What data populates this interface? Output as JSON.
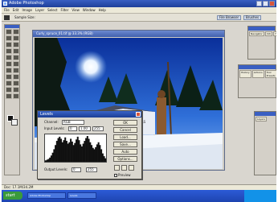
{
  "app": {
    "title": "Adobe Photoshop"
  },
  "menu": [
    "File",
    "Edit",
    "Image",
    "Layer",
    "Select",
    "Filter",
    "View",
    "Window",
    "Help"
  ],
  "options_bar": {
    "sample_label": "Sample Size:",
    "file_browser": "File Browser",
    "brushes": "Brushes"
  },
  "image_window": {
    "title": "Curly_spruce_01.tif @ 33.3% (RGB)"
  },
  "photo": {
    "sign_text": "UNITY ONE\nSPIRIT LEADERS"
  },
  "navigator": {
    "tabs": [
      "Navigator",
      "Info",
      "Histogram"
    ]
  },
  "history": {
    "tabs": [
      "History",
      "Actions",
      "Tool Presets"
    ]
  },
  "layers": {
    "tabs": [
      "Layers"
    ]
  },
  "levels": {
    "title": "Levels",
    "channel_label": "Channel:",
    "channel_value": "RGB",
    "input_label": "Input Levels:",
    "input_values": [
      "0",
      "1.00",
      "255"
    ],
    "output_label": "Output Levels:",
    "output_values": [
      "0",
      "255"
    ],
    "buttons": [
      "OK",
      "Cancel",
      "Load...",
      "Save...",
      "Auto",
      "Options..."
    ],
    "preview_label": "Preview",
    "histogram": [
      2,
      3,
      4,
      6,
      9,
      13,
      18,
      24,
      30,
      34,
      36,
      33,
      28,
      31,
      35,
      30,
      26,
      28,
      33,
      29,
      24,
      27,
      32,
      36,
      31,
      25,
      22,
      26,
      30,
      34,
      37,
      33,
      28,
      24,
      20,
      18,
      21,
      25,
      28,
      24,
      18,
      12,
      8,
      5
    ]
  },
  "status": {
    "text": "Doc: 17.1M/34.2M"
  },
  "taskbar": {
    "start": "start",
    "tasks": [
      "Adobe Photoshop",
      "Levels"
    ]
  }
}
